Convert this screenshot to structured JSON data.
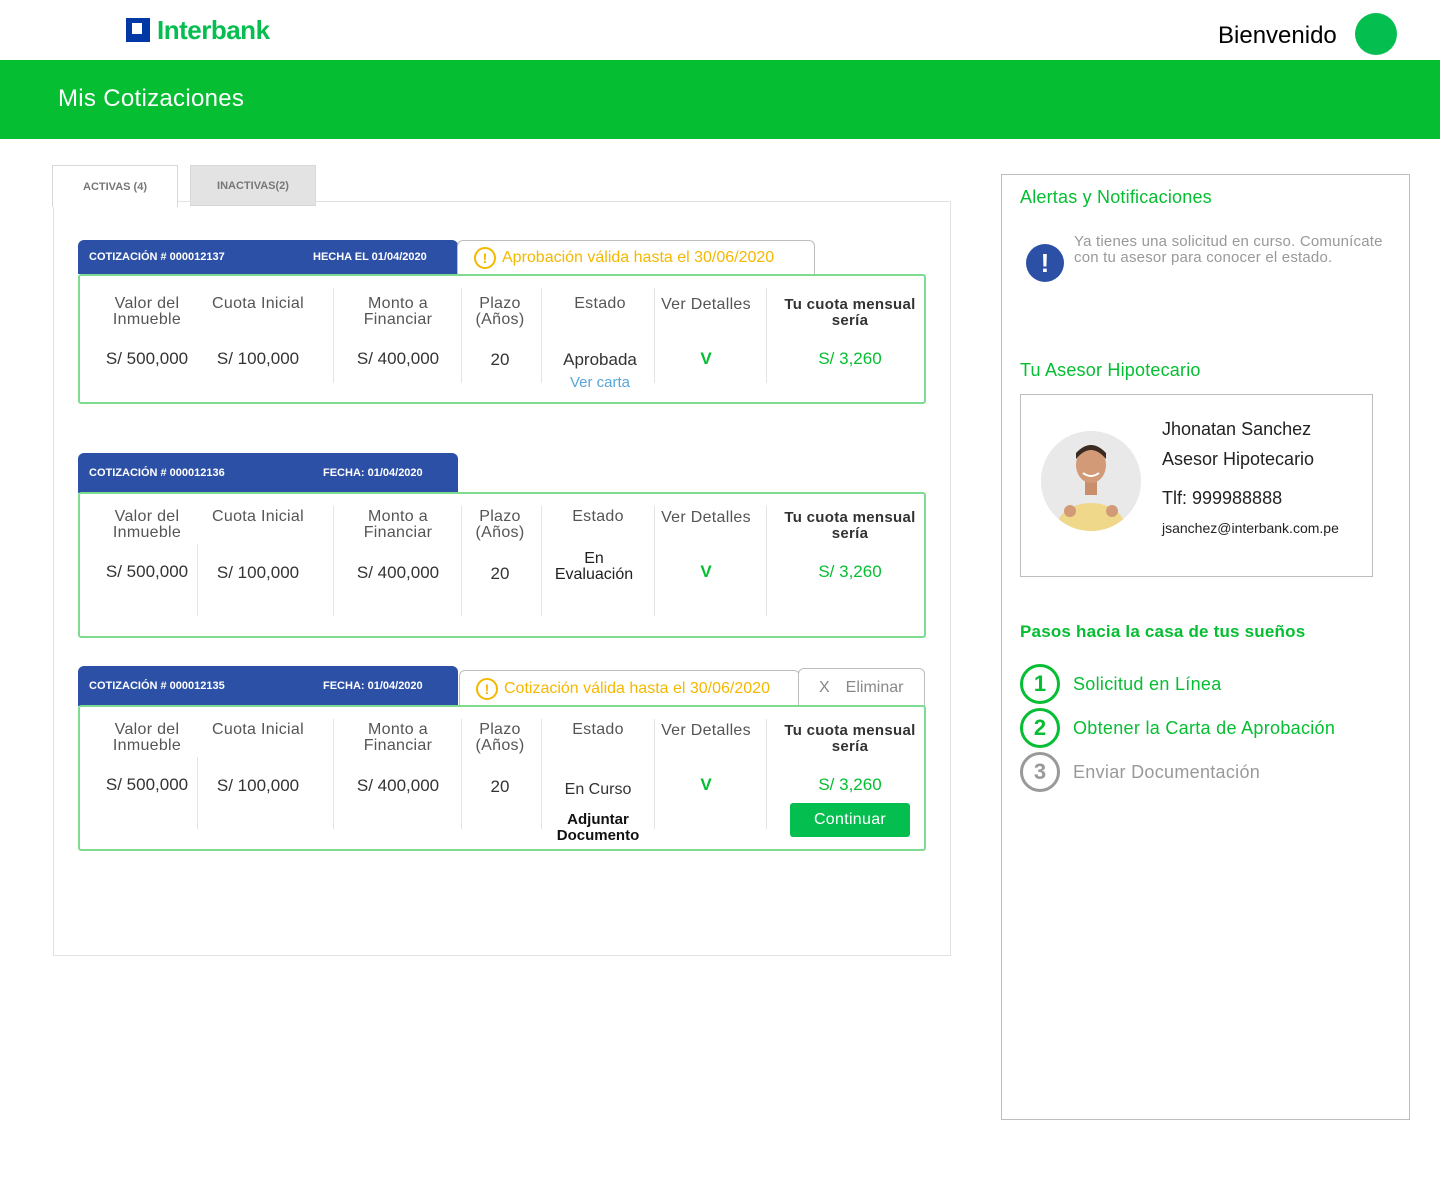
{
  "header": {
    "brand": "Interbank",
    "welcome": "Bienvenido",
    "page_title": "Mis Cotizaciones"
  },
  "tabs": [
    {
      "label": "ACTIVAS (4)",
      "active": true
    },
    {
      "label": "INACTIVAS(2)",
      "active": false
    }
  ],
  "columns": {
    "valor": "Valor del Inmueble",
    "cuota": "Cuota Inicial",
    "monto": "Monto a Financiar",
    "plazo": "Plazo (Años)",
    "estado": "Estado",
    "detalles": "Ver Detalles",
    "mensual": "Tu cuota mensual sería"
  },
  "quotes": [
    {
      "number": "COTIZACIÓN # 000012137",
      "date": "HECHA EL 01/04/2020",
      "alert": "Aprobación válida hasta el 30/06/2020",
      "valor": "S/ 500,000",
      "cuota": "S/ 100,000",
      "monto": "S/ 400,000",
      "plazo": "20",
      "estado": "Aprobada",
      "estado_link": "Ver carta",
      "detalles": "V",
      "mensual": "S/ 3,260"
    },
    {
      "number": "COTIZACIÓN # 000012136",
      "date": "FECHA: 01/04/2020",
      "valor": "S/ 500,000",
      "cuota": "S/ 100,000",
      "monto": "S/ 400,000",
      "plazo": "20",
      "estado": "En Evaluación",
      "detalles": "V",
      "mensual": "S/ 3,260"
    },
    {
      "number": "COTIZACIÓN # 000012135",
      "date": "FECHA: 01/04/2020",
      "alert": "Cotización válida hasta el 30/06/2020",
      "delete_x": "X",
      "delete_label": "Eliminar",
      "valor": "S/ 500,000",
      "cuota": "S/ 100,000",
      "monto": "S/ 400,000",
      "plazo": "20",
      "estado": "En Curso",
      "estado_action": "Adjuntar Documento",
      "detalles": "V",
      "mensual": "S/ 3,260",
      "continue_label": "Continuar"
    }
  ],
  "sidebar": {
    "alerts_title": "Alertas y Notificaciones",
    "alert_icon": "!",
    "alert_text": "Ya tienes una solicitud en curso. Comunícate con tu asesor para conocer el estado.",
    "advisor_title": "Tu Asesor Hipotecario",
    "advisor": {
      "name": "Jhonatan Sanchez",
      "role": "Asesor Hipotecario",
      "phone": "Tlf: 999988888",
      "email": "jsanchez@interbank.com.pe"
    },
    "steps_title": "Pasos hacia la casa de tus sueños",
    "steps": [
      {
        "number": "1",
        "label": "Solicitud en  Línea",
        "done": true
      },
      {
        "number": "2",
        "label": "Obtener la Carta de Aprobación",
        "done": true
      },
      {
        "number": "3",
        "label": "Enviar Documentación",
        "done": false
      }
    ]
  },
  "colors": {
    "brand_green": "#05be32",
    "brand_blue": "#2c50a6",
    "warning": "#f5b800"
  }
}
